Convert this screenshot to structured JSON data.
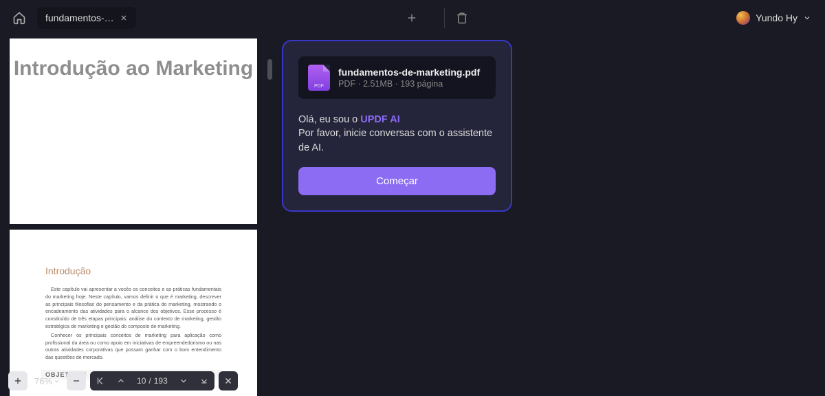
{
  "tab": {
    "title": "fundamentos-…"
  },
  "user": {
    "name": "Yundo Hy"
  },
  "pdf": {
    "page1_title": "Introdução ao Marketing",
    "page2_heading": "Introdução",
    "page2_para1": "Este capítulo vai apresentar a vocês os conceitos e as práticas fundamentais do marketing hoje. Neste capítulo, vamos definir o que é marketing, descrever as principais filosofias do pensamento e da prática do marketing, mostrando o encadeamento das atividades para o alcance dos objetivos. Esse processo é constituído de três etapas principais: análise do contexto de marketing, gestão estratégica de marketing e gestão do composto de marketing.",
    "page2_para2": "Conhecer os principais conceitos de marketing para aplicação como profissional da área ou como apoio em iniciativas de empreendedorismo ou nas outras atividades corporativas que possam ganhar com o bom entendimento das questões de mercado.",
    "page2_objectives": "OBJETIVOS"
  },
  "toolbar": {
    "zoom": "76%",
    "current_page": "10",
    "total_pages": "193"
  },
  "ai": {
    "file_name": "fundamentos-de-marketing.pdf",
    "file_meta": "PDF · 2.51MB · 193 página",
    "greeting_prefix": "Olá, eu sou o ",
    "greeting_brand": "UPDF AI",
    "greeting_line2": "Por favor, inicie conversas com o assistente de AI.",
    "start_label": "Começar"
  }
}
